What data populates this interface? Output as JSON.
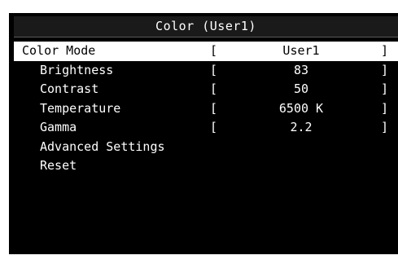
{
  "window": {
    "title": "Color (User1)"
  },
  "menu": {
    "color_mode": {
      "label": "Color Mode",
      "value": "User1",
      "open": "[",
      "close": "]"
    },
    "brightness": {
      "label": "Brightness",
      "value": "83",
      "open": "[",
      "close": "]"
    },
    "contrast": {
      "label": "Contrast",
      "value": "50",
      "open": "[",
      "close": "]"
    },
    "temperature": {
      "label": "Temperature",
      "value": "6500 K",
      "open": "[",
      "close": "]"
    },
    "gamma": {
      "label": "Gamma",
      "value": "2.2",
      "open": "[",
      "close": "]"
    },
    "advanced_settings": {
      "label": "Advanced Settings"
    },
    "reset": {
      "label": "Reset"
    }
  },
  "colors": {
    "background": "#000000",
    "text": "#ffffff",
    "highlight": "#ffffff",
    "highlight_text": "#000000"
  }
}
